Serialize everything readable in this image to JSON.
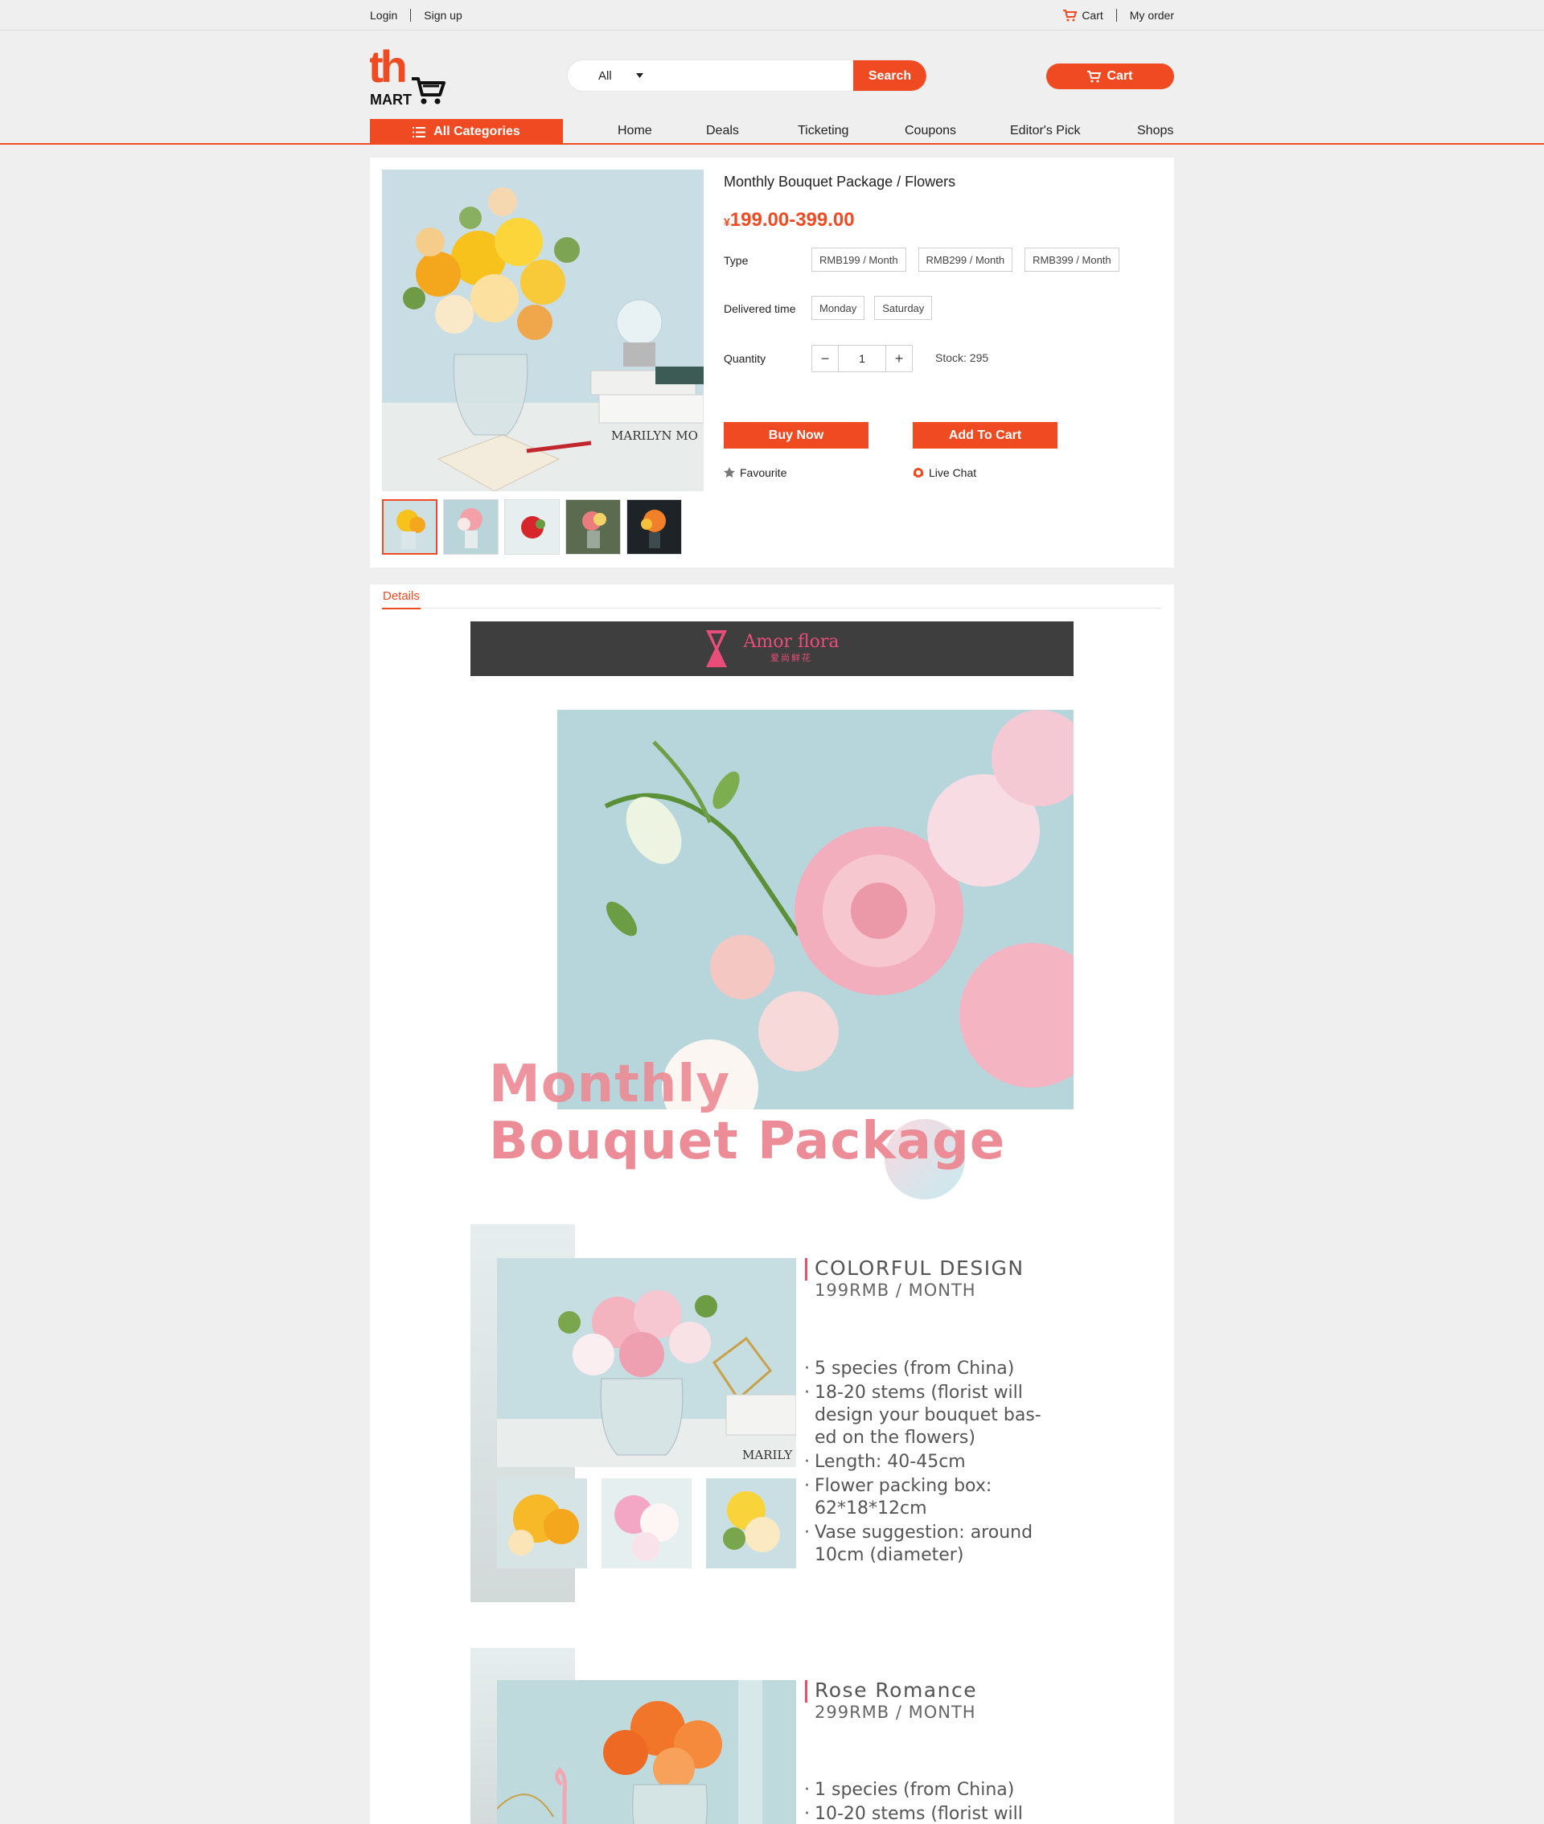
{
  "topbar": {
    "login": "Login",
    "signup": "Sign up",
    "cart": "Cart",
    "my_order": "My order"
  },
  "header": {
    "logo_top": "th",
    "logo_bottom": "MART",
    "search_category": "All",
    "search_placeholder": "",
    "search_button": "Search",
    "cart_button": "Cart"
  },
  "nav": {
    "all_categories": "All Categories",
    "items": [
      "Home",
      "Deals",
      "Ticketing",
      "Coupons",
      "Editor's Pick",
      "Shops"
    ]
  },
  "product": {
    "title": "Monthly Bouquet Package / Flowers",
    "currency": "¥",
    "price": "199.00-399.00",
    "type_label": "Type",
    "types": [
      "RMB199 / Month",
      "RMB299 / Month",
      "RMB399 / Month"
    ],
    "delivery_label": "Delivered time",
    "delivery_options": [
      "Monday",
      "Saturday"
    ],
    "quantity_label": "Quantity",
    "quantity": "1",
    "stock": "Stock: 295",
    "buy_now": "Buy Now",
    "add_to_cart": "Add To Cart",
    "favourite": "Favourite",
    "live_chat": "Live Chat"
  },
  "details": {
    "tab": "Details",
    "brand_name": "Amor flora",
    "brand_sub": "爱尚鲜花",
    "hero_line1": "Monthly",
    "hero_line2": "Bouquet Package",
    "section1": {
      "title": "COLORFUL DESIGN",
      "subtitle": "199RMB / MONTH",
      "photo_caption": "MARILY",
      "bullets": [
        "5 species (from China)",
        "18-20 stems (florist will design your bouquet bas-ed on the flowers)",
        "Length: 40-45cm",
        "Flower packing box: 62*18*12cm",
        "Vase suggestion: around 10cm (diameter)"
      ]
    },
    "section2": {
      "title": "Rose Romance",
      "subtitle": "299RMB / MONTH",
      "bullets": [
        "1 species (from China)",
        "10-20 stems (florist will"
      ]
    }
  },
  "colors": {
    "accent": "#f04a22",
    "pink": "#ec8c96",
    "page_bg": "#efefef"
  },
  "icons": [
    "cart-icon",
    "caret-down-icon",
    "menu-list-icon",
    "star-icon",
    "chat-icon"
  ]
}
